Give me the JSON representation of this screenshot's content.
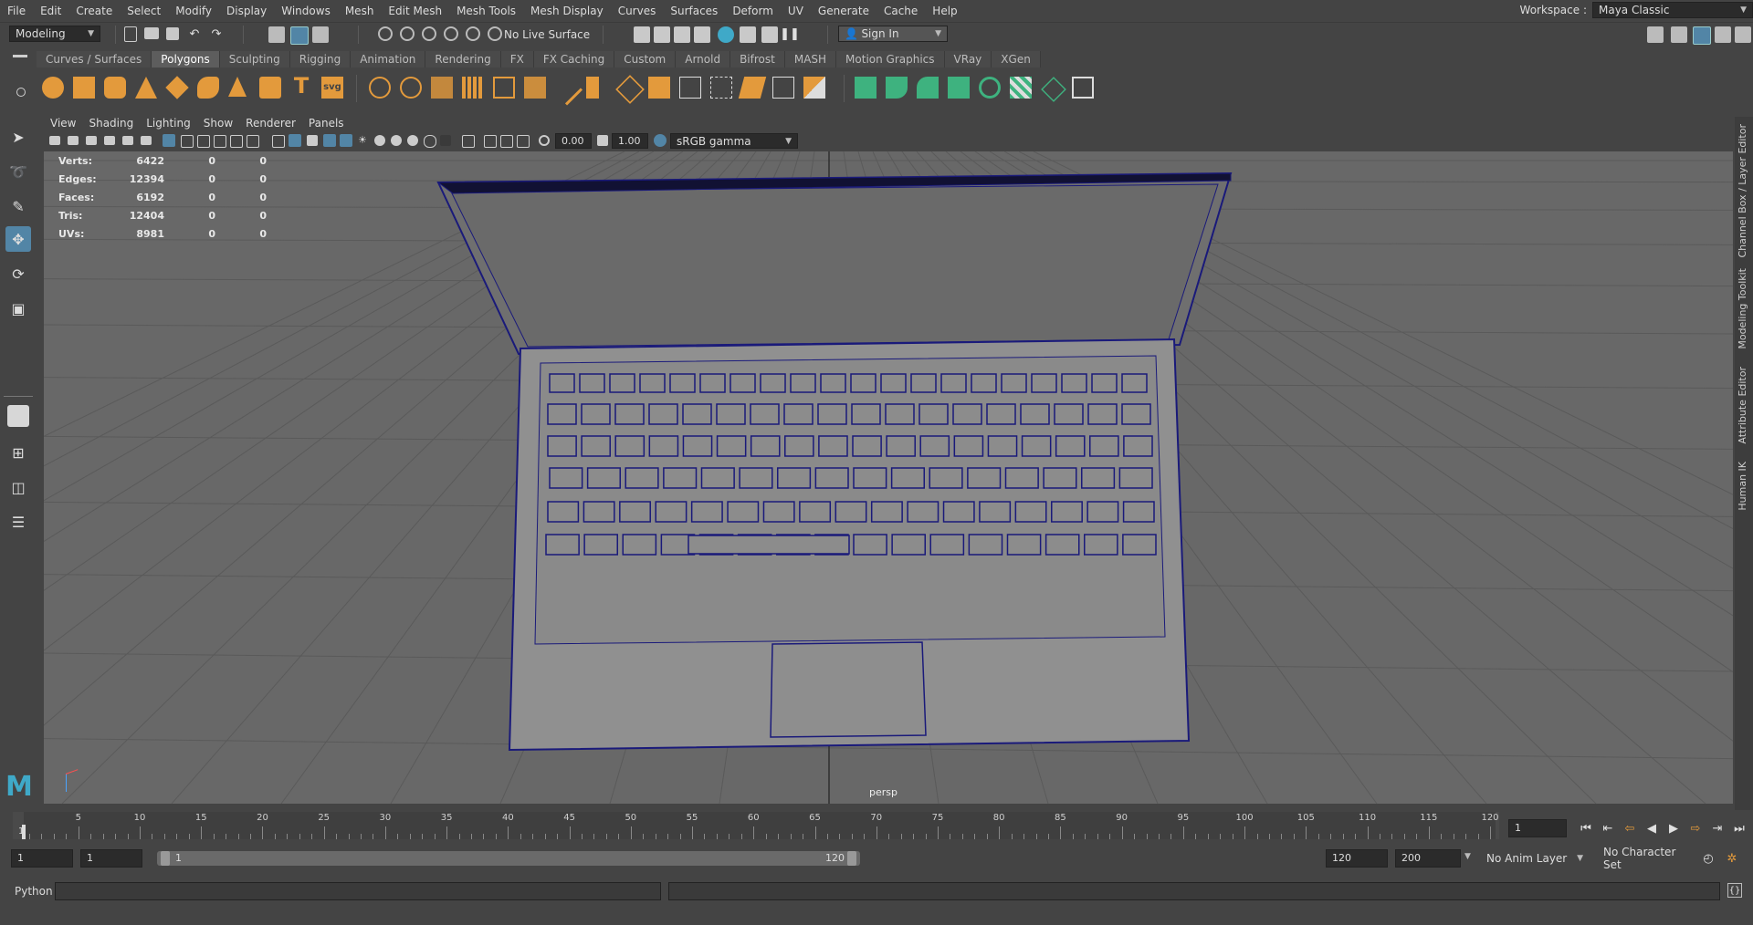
{
  "menu": [
    "File",
    "Edit",
    "Create",
    "Select",
    "Modify",
    "Display",
    "Windows",
    "Mesh",
    "Edit Mesh",
    "Mesh Tools",
    "Mesh Display",
    "Curves",
    "Surfaces",
    "Deform",
    "UV",
    "Generate",
    "Cache",
    "Help"
  ],
  "workspace": {
    "label": "Workspace :",
    "value": "Maya Classic"
  },
  "status": {
    "mode": "Modeling",
    "live_surface": "No Live Surface",
    "sign_in": "Sign In"
  },
  "shelf_tabs": [
    "Curves / Surfaces",
    "Polygons",
    "Sculpting",
    "Rigging",
    "Animation",
    "Rendering",
    "FX",
    "FX Caching",
    "Custom",
    "Arnold",
    "Bifrost",
    "MASH",
    "Motion Graphics",
    "VRay",
    "XGen"
  ],
  "shelf_active_tab": "Polygons",
  "shelf_svg_label": "svg",
  "panel_menu": [
    "View",
    "Shading",
    "Lighting",
    "Show",
    "Renderer",
    "Panels"
  ],
  "view_toolbar": {
    "exposure": "0.00",
    "gamma": "1.00",
    "color_space": "sRGB gamma"
  },
  "hud": [
    {
      "label": "Verts:",
      "value": "6422",
      "sel": "0",
      "sel2": "0"
    },
    {
      "label": "Edges:",
      "value": "12394",
      "sel": "0",
      "sel2": "0"
    },
    {
      "label": "Faces:",
      "value": "6192",
      "sel": "0",
      "sel2": "0"
    },
    {
      "label": "Tris:",
      "value": "12404",
      "sel": "0",
      "sel2": "0"
    },
    {
      "label": "UVs:",
      "value": "8981",
      "sel": "0",
      "sel2": "0"
    }
  ],
  "camera": "persp",
  "right_tabs": [
    "Channel Box / Layer Editor",
    "Modeling Toolkit",
    "Attribute Editor",
    "Human IK"
  ],
  "timeline": {
    "ticks": [
      "5",
      "10",
      "15",
      "20",
      "25",
      "30",
      "35",
      "40",
      "45",
      "50",
      "55",
      "60",
      "65",
      "70",
      "75",
      "80",
      "85",
      "90",
      "95",
      "100",
      "105",
      "110",
      "115",
      "120"
    ],
    "first": "1",
    "current": "1"
  },
  "range": {
    "start": "1",
    "start2": "1",
    "slider_start": "1",
    "slider_end": "120",
    "end": "120",
    "end2": "200",
    "anim_layer": "No Anim Layer",
    "char_set": "No Character Set"
  },
  "command": {
    "label": "Python"
  },
  "colors": {
    "bg": "#444444",
    "viewport": "#686868",
    "wire": "#1a1a7a",
    "accent": "#5285a6",
    "shelf_orange": "#e39a3c",
    "shelf_green": "#3eb27f"
  },
  "icons": [
    "select-tool-icon",
    "lasso-tool-icon",
    "paint-select-icon",
    "move-tool-icon",
    "rotate-tool-icon",
    "scale-tool-icon",
    "maya-logo-icon"
  ]
}
